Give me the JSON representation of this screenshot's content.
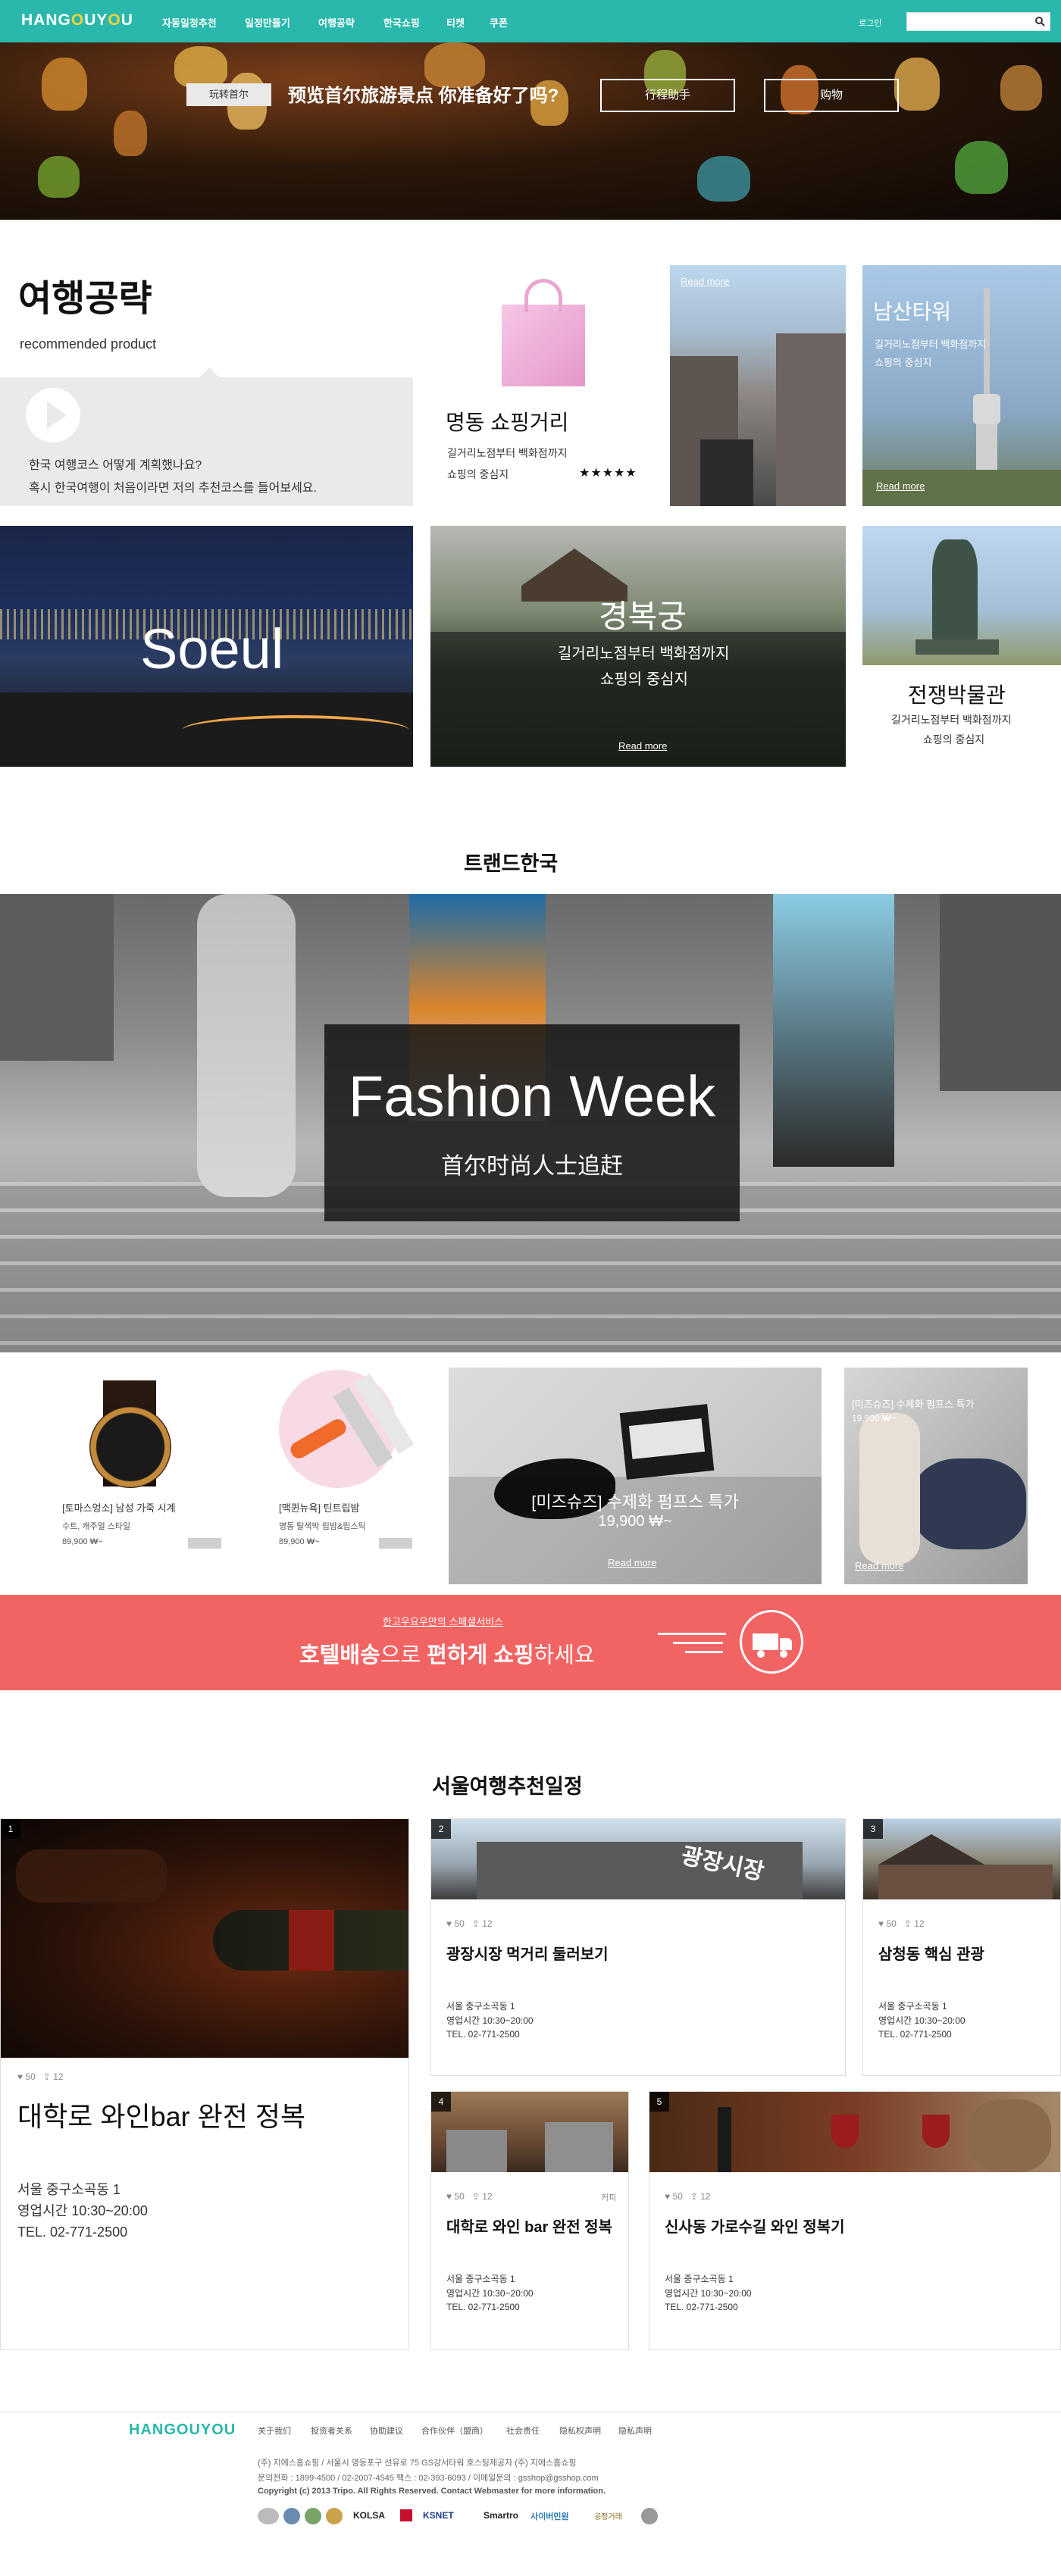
{
  "header": {
    "logo": "HANG",
    "logo_o": "O",
    "logo_mid": "UY",
    "logo_o2": "O",
    "logo_end": "U",
    "nav": [
      "자동일정추천",
      "일정만들기",
      "여행공략",
      "한국쇼핑",
      "티켓",
      "쿠폰"
    ],
    "login": "로그인",
    "search_placeholder": ""
  },
  "hero": {
    "tag": "玩转首尔",
    "title": "预览首尔旅游景点 你准备好了吗?",
    "button_plan": "行程助手",
    "button_shop": "购物"
  },
  "travel": {
    "title": "여행공략",
    "subtitle": "recommended product",
    "intro_line1": "한국 여행코스 어떻게 계획했나요?",
    "intro_line2": "혹시 한국여행이 처음이라면 저의 추천코스를 들어보세요.",
    "myeongdong_title": "명동 쇼핑거리",
    "myeongdong_desc1": "길거리노점부터 백화점까지",
    "myeongdong_desc2": "쇼핑의 중심지",
    "myeongdong_rating": 5,
    "street_read": "Read more",
    "namsan_title": "남산타워",
    "namsan_desc1": "길거리노점부터 백화점까지",
    "namsan_desc2": "쇼핑의 중심지",
    "namsan_read": "Read more",
    "seoul_label": "Soeul",
    "gyeong_title": "경복궁",
    "gyeong_desc1": "길거리노점부터 백화점까지",
    "gyeong_desc2": "쇼핑의 중심지",
    "gyeong_read": "Read more",
    "war_title": "전쟁박물관",
    "war_desc1": "길거리노점부터 백화점까지",
    "war_desc2": "쇼핑의 중심지"
  },
  "trend": {
    "title": "트랜드한국",
    "fashion_title": "Fashion Week",
    "fashion_sub": "首尔时尚人士追赶"
  },
  "products": [
    {
      "name": "[토마스엉소] 남성 가죽 시계",
      "sub": "수트, 캐주얼 스타일",
      "price": "89,900 ₩~"
    },
    {
      "name": "[맥퀸뉴욕] 틴트립밤",
      "sub": "명동 탈색막 립밤&립스틱",
      "price": "89,900 ₩~"
    }
  ],
  "shoes": {
    "title": "[미즈슈즈] 수제화 펌프스 특가",
    "price": "19,900 ₩~",
    "read": "Read more",
    "small_title": "[미즈슈즈] 수제화 펌프스 특가",
    "small_price": "19,900 ₩~",
    "small_read": "Read more"
  },
  "banner": {
    "kicker": "한고우요우만의 스페셜서비스",
    "main_bold1": "호텔배송",
    "main_mid": "으로 ",
    "main_bold2": "편하게 쇼핑",
    "main_end": "하세요"
  },
  "itinerary": {
    "title": "서울여행추천일정",
    "cards": [
      {
        "num": "1",
        "likes": "50",
        "shares": "12",
        "title": "대학로 와인bar 완전 정복",
        "addr1": "서울 중구소곡동 1",
        "addr2": "영업시간 10:30~20:00",
        "addr3": "TEL. 02-771-2500"
      },
      {
        "num": "2",
        "likes": "50",
        "shares": "12",
        "title": "광장시장 먹거리 둘러보기",
        "addr1": "서울 중구소곡동 1",
        "addr2": "영업시간 10:30~20:00",
        "addr3": "TEL. 02-771-2500",
        "sign": "광장시장"
      },
      {
        "num": "3",
        "likes": "50",
        "shares": "12",
        "title": "삼청동 핵심 관광",
        "addr1": "서울 중구소곡동 1",
        "addr2": "영업시간 10:30~20:00",
        "addr3": "TEL. 02-771-2500"
      },
      {
        "num": "4",
        "likes": "50",
        "shares": "12",
        "title": "대학로 와인 bar 완전 정복",
        "addr1": "서울 중구소곡동 1",
        "addr2": "영업시간 10:30~20:00",
        "addr3": "TEL. 02-771-2500",
        "tag": "커피"
      },
      {
        "num": "5",
        "likes": "50",
        "shares": "12",
        "title": "신사동 가로수길 와인 정복기",
        "addr1": "서울 중구소곡동 1",
        "addr2": "영업시간 10:30~20:00",
        "addr3": "TEL. 02-771-2500"
      }
    ]
  },
  "footer": {
    "logo": "HANGOUYOU",
    "links": [
      "关于我们",
      "投资者关系",
      "协助建议",
      "合作伙伴（盟商）",
      "社会责任",
      "隐私权声明",
      "隐私声明"
    ],
    "info1": "(주) 지에스홈쇼핑  /  서울시 영등포구 선유로 75 GS강서타워 호스팅제공자 (주) 지에스홈쇼핑",
    "info2": "문의전화 : 1899-4500 / 02-2007-4545 팩스 : 02-393-6093 / 이메일문의 : gsshop@gsshop.com",
    "info3": "Copyright (c) 2013 Tripo. All Rights Reserved. Contact Webmaster for more information.",
    "certs": [
      "KOLSA",
      "KSNET",
      "Smartro",
      "사이버민원",
      "공정거래"
    ]
  },
  "colors": {
    "teal": "#29b8ab",
    "banner_red": "#f26463"
  }
}
